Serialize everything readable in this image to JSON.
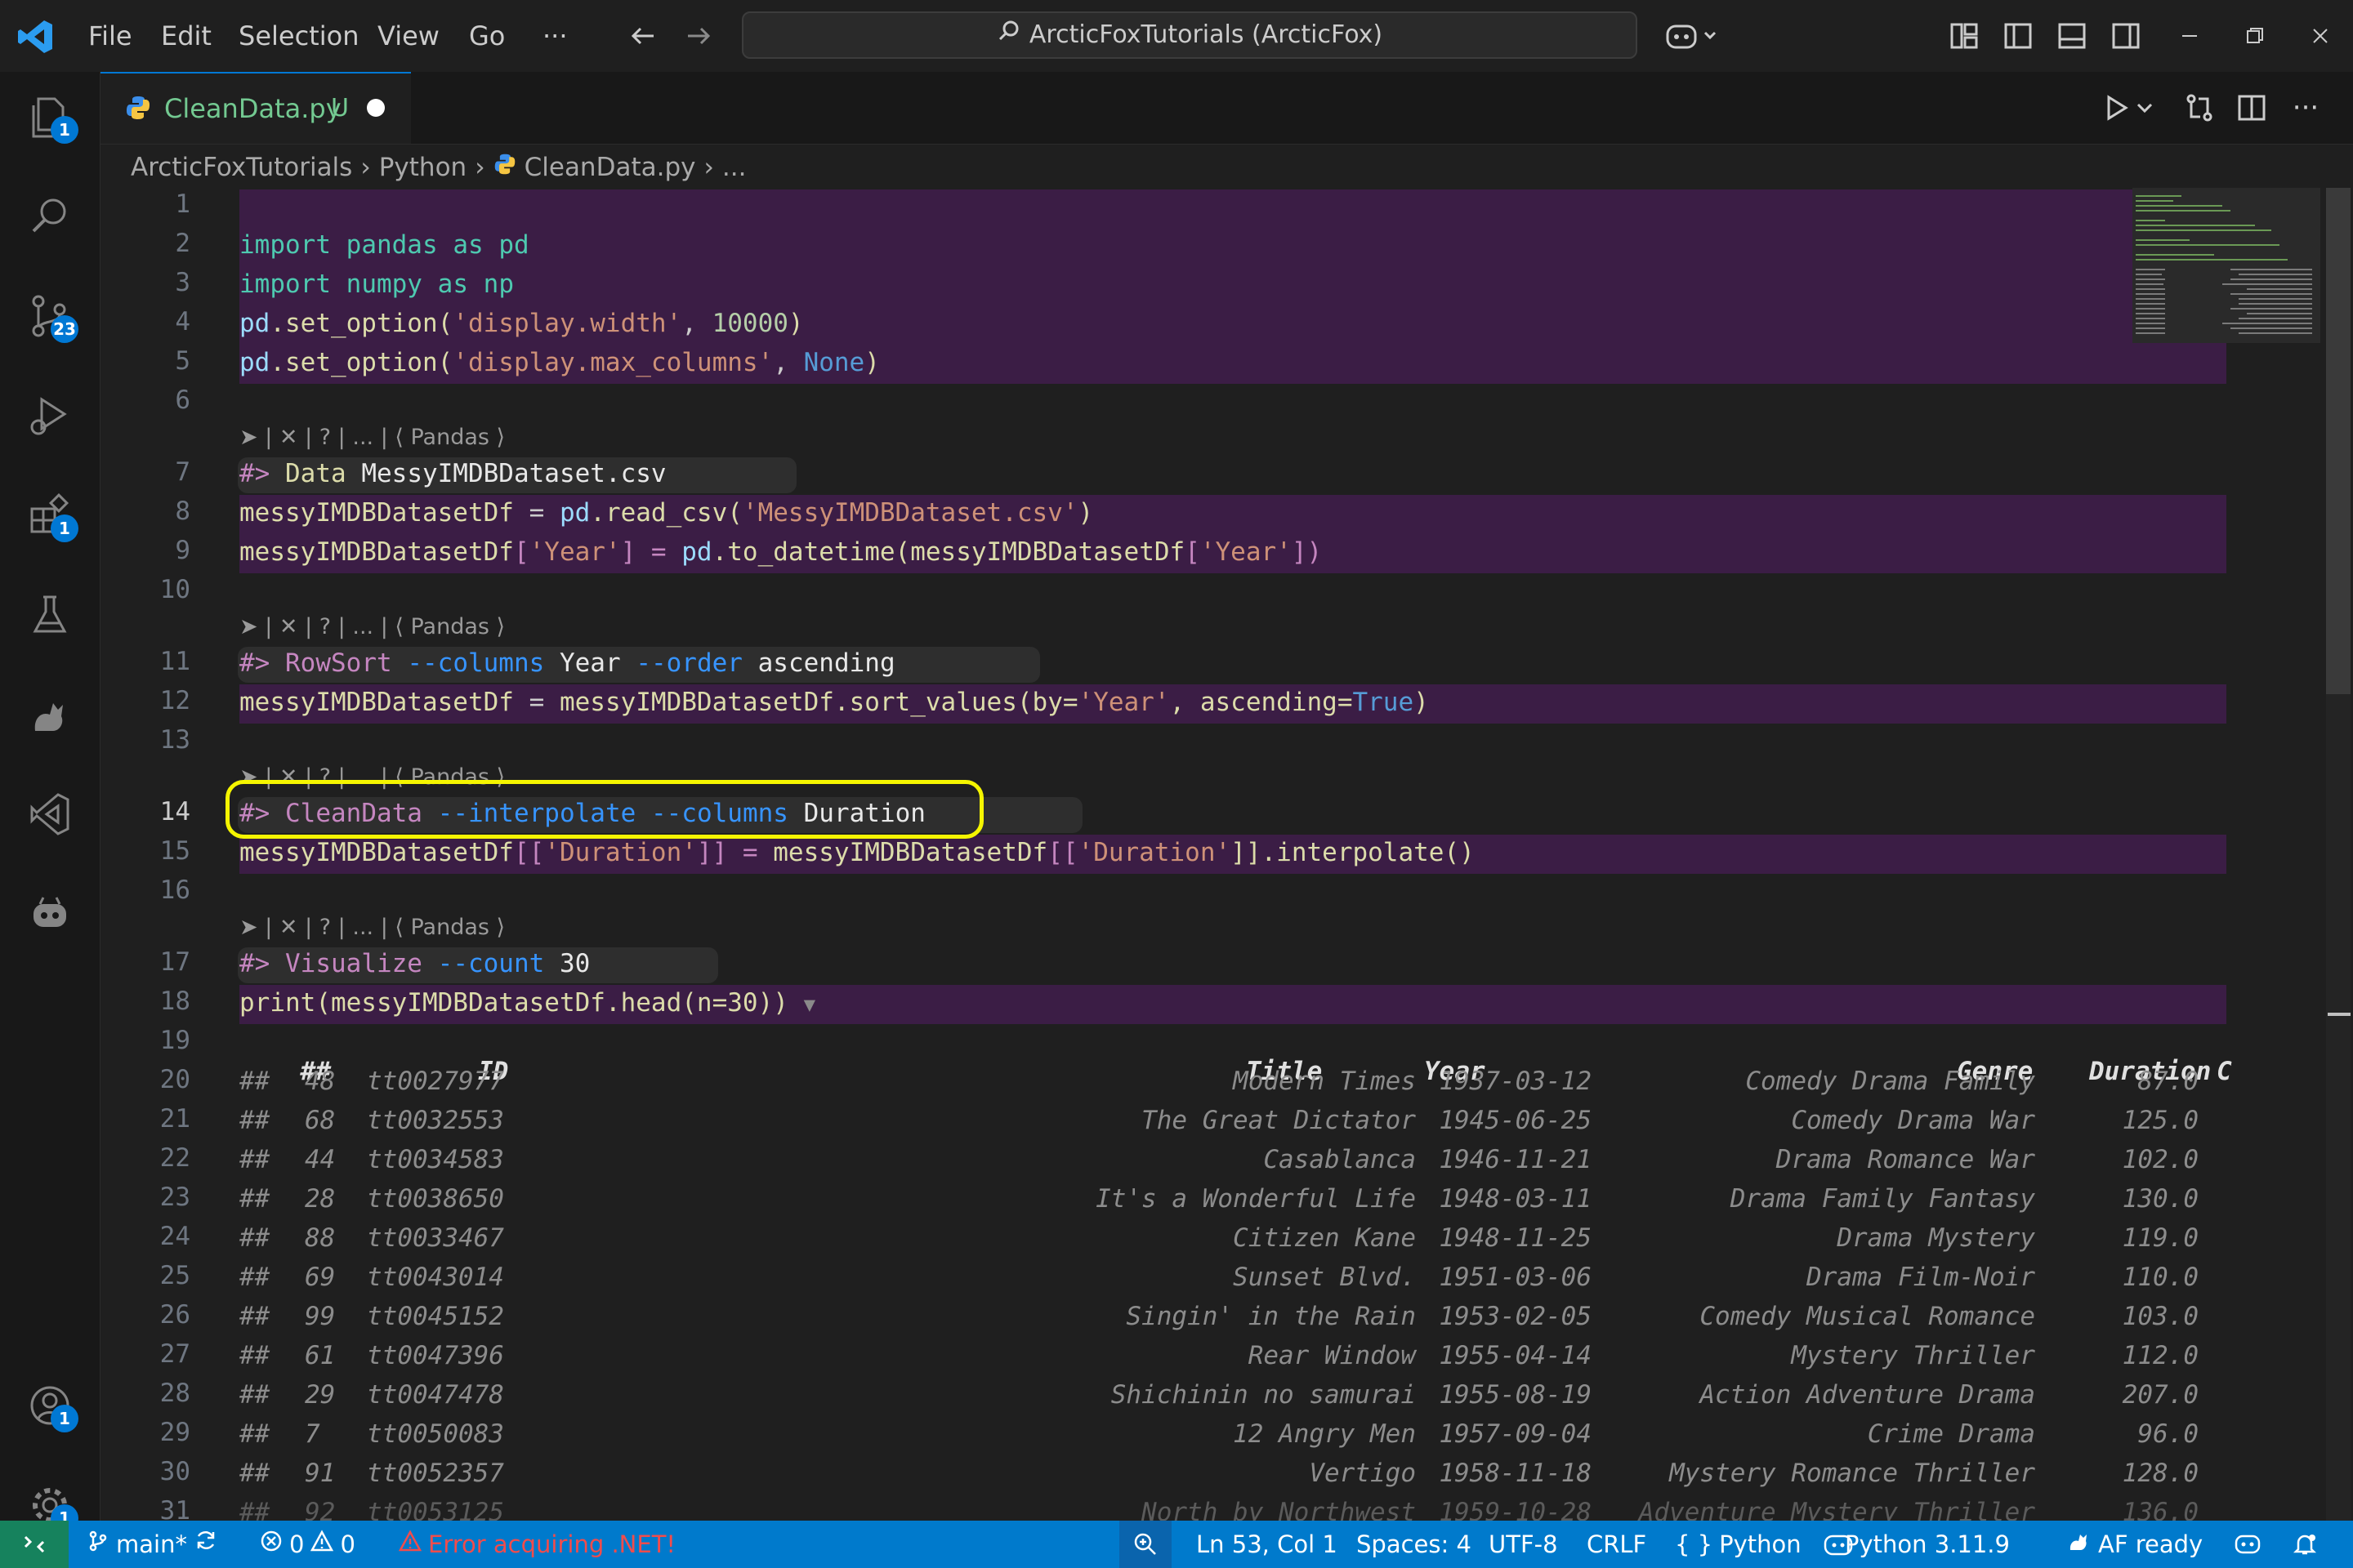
{
  "titlebar": {
    "menus": [
      "File",
      "Edit",
      "Selection",
      "View",
      "Go"
    ],
    "more": "···",
    "search_text": "ArcticFoxTutorials (ArcticFox)"
  },
  "activity_badges": {
    "explorer": "1",
    "source_control": "23",
    "extensions": "1",
    "accounts": "1",
    "settings": "1"
  },
  "tab": {
    "filename": "CleanData.py",
    "status": "U"
  },
  "breadcrumb": [
    "ArcticFoxTutorials",
    "Python",
    "CleanData.py",
    "..."
  ],
  "code_lens": "➤ | ✕ | ? | ... | ⟨ Pandas ⟩",
  "code": {
    "l2": [
      "import",
      "pandas",
      "as",
      "pd"
    ],
    "l3": [
      "import",
      "numpy",
      "as",
      "np"
    ],
    "l4": [
      "pd",
      ".set_option(",
      "'display.width'",
      ", ",
      "10000",
      ")"
    ],
    "l5": [
      "pd",
      ".set_option(",
      "'display.max_columns'",
      ", ",
      "None",
      ")"
    ],
    "l7": [
      "#>",
      "Data",
      "MessyIMDBDataset.csv"
    ],
    "l8": [
      "messyIMDBDatasetDf",
      " = ",
      "pd",
      ".read_csv(",
      "'MessyIMDBDataset.csv'",
      ")"
    ],
    "l9": [
      "messyIMDBDatasetDf",
      "[",
      "'Year'",
      "] = ",
      "pd",
      ".to_datetime(",
      "messyIMDBDatasetDf",
      "[",
      "'Year'",
      "])"
    ],
    "l11": [
      "#>",
      "RowSort",
      "--columns",
      "Year",
      "--order",
      "ascending"
    ],
    "l12": [
      "messyIMDBDatasetDf",
      " = ",
      "messyIMDBDatasetDf",
      ".sort_values(by=",
      "'Year'",
      ", ascending=",
      "True",
      ")"
    ],
    "l14": [
      "#>",
      "CleanData",
      "--interpolate",
      "--columns",
      "Duration"
    ],
    "l15": [
      "messyIMDBDatasetDf",
      "[[",
      "'Duration'",
      "]] = ",
      "messyIMDBDatasetDf",
      "[[",
      "'Duration'",
      "]].interpolate()"
    ],
    "l17": [
      "#>",
      "Visualize",
      "--count",
      "30"
    ],
    "l18": [
      "print(",
      "messyIMDBDatasetDf",
      ".head(n=30))",
      "▼"
    ]
  },
  "table": {
    "prefix": "##",
    "headers": [
      "ID",
      "Title",
      "Year",
      "Genre",
      "Duration",
      "C"
    ],
    "rows": [
      [
        "48",
        "tt0027977",
        "Modern Times",
        "1937-03-12",
        "Comedy Drama Family",
        "87.0"
      ],
      [
        "68",
        "tt0032553",
        "The Great Dictator",
        "1945-06-25",
        "Comedy Drama War",
        "125.0"
      ],
      [
        "44",
        "tt0034583",
        "Casablanca",
        "1946-11-21",
        "Drama Romance War",
        "102.0"
      ],
      [
        "28",
        "tt0038650",
        "It's a Wonderful Life",
        "1948-03-11",
        "Drama Family Fantasy",
        "130.0"
      ],
      [
        "88",
        "tt0033467",
        "Citizen Kane",
        "1948-11-25",
        "Drama Mystery",
        "119.0"
      ],
      [
        "69",
        "tt0043014",
        "Sunset Blvd.",
        "1951-03-06",
        "Drama Film-Noir",
        "110.0"
      ],
      [
        "99",
        "tt0045152",
        "Singin' in the Rain",
        "1953-02-05",
        "Comedy Musical Romance",
        "103.0"
      ],
      [
        "61",
        "tt0047396",
        "Rear Window",
        "1955-04-14",
        "Mystery Thriller",
        "112.0"
      ],
      [
        "29",
        "tt0047478",
        "Shichinin no samurai",
        "1955-08-19",
        "Action Adventure Drama",
        "207.0"
      ],
      [
        "7",
        "tt0050083",
        "12 Angry Men",
        "1957-09-04",
        "Crime Drama",
        "96.0"
      ],
      [
        "91",
        "tt0052357",
        "Vertigo",
        "1958-11-18",
        "Mystery Romance Thriller",
        "128.0"
      ],
      [
        "92",
        "tt0053125",
        "North by Northwest",
        "1959-10-28",
        "Adventure Mystery Thriller",
        "136.0"
      ]
    ]
  },
  "line_numbers": [
    "1",
    "2",
    "3",
    "4",
    "5",
    "6",
    "7",
    "8",
    "9",
    "10",
    "11",
    "12",
    "13",
    "14",
    "15",
    "16",
    "17",
    "18",
    "19",
    "20",
    "21",
    "22",
    "23",
    "24",
    "25",
    "26",
    "27",
    "28",
    "29",
    "30",
    "31"
  ],
  "statusbar": {
    "branch": "main*",
    "errors": "0",
    "warnings": "0",
    "error_msg": "Error acquiring .NET!",
    "position": "Ln 53, Col 1",
    "spaces": "Spaces: 4",
    "encoding": "UTF-8",
    "eol": "CRLF",
    "language": "Python",
    "interpreter": "Python 3.11.9",
    "af_status": "AF ready"
  },
  "colors": {
    "accent": "#0078d4",
    "status_bg": "#007acc",
    "cell_bg": "#3b1d45",
    "highlight_ring": "#f5f500",
    "error": "#f14c4c"
  }
}
